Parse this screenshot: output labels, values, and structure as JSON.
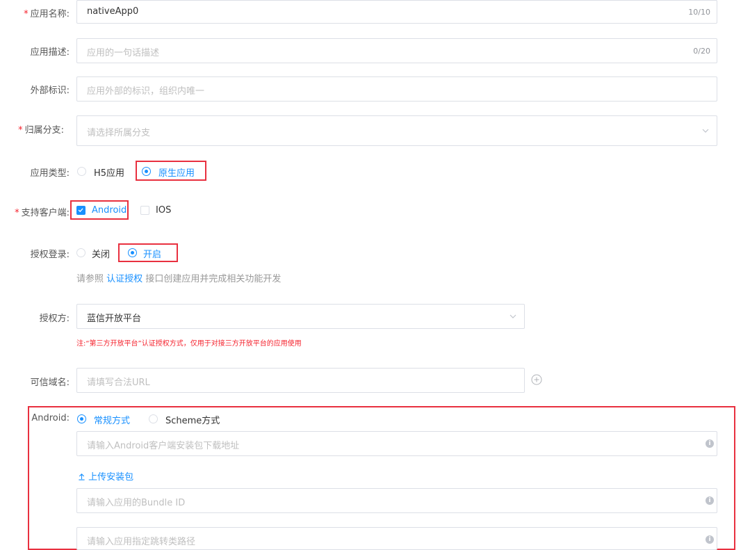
{
  "app_name": {
    "label": "应用名称:",
    "value": "nativeApp0",
    "count": "10/10"
  },
  "app_desc": {
    "label": "应用描述:",
    "placeholder": "应用的一句话描述",
    "count": "0/20"
  },
  "external_id": {
    "label": "外部标识:",
    "placeholder": "应用外部的标识，组织内唯一"
  },
  "branch": {
    "label": "归属分支:",
    "placeholder": "请选择所属分支"
  },
  "app_type": {
    "label": "应用类型:",
    "options": [
      "H5应用",
      "原生应用"
    ],
    "selected": "原生应用"
  },
  "clients": {
    "label": "支持客户端:",
    "options": [
      "Android",
      "IOS"
    ],
    "checked": [
      "Android"
    ]
  },
  "auth_login": {
    "label": "授权登录:",
    "options": [
      "关闭",
      "开启"
    ],
    "selected": "开启",
    "hint_prefix": "请参照",
    "hint_link": "认证授权",
    "hint_suffix": "接口创建应用并完成相关功能开发"
  },
  "auth_party": {
    "label": "授权方:",
    "value": "蓝信开放平台",
    "note": "注:“第三方开放平台”认证授权方式，仅用于对接三方开放平台的应用使用"
  },
  "trusted_domain": {
    "label": "可信域名:",
    "placeholder": "请填写合法URL"
  },
  "android": {
    "label": "Android:",
    "modes": [
      "常规方式",
      "Scheme方式"
    ],
    "selected_mode": "常规方式",
    "download_placeholder": "请输入Android客户端安装包下载地址",
    "upload_label": "上传安装包",
    "bundle_placeholder": "请输入应用的Bundle ID",
    "path_placeholder": "请输入应用指定跳转类路径"
  },
  "colors": {
    "accent": "#1890ff",
    "highlight": "#e8303f",
    "required": "#f5222d"
  }
}
